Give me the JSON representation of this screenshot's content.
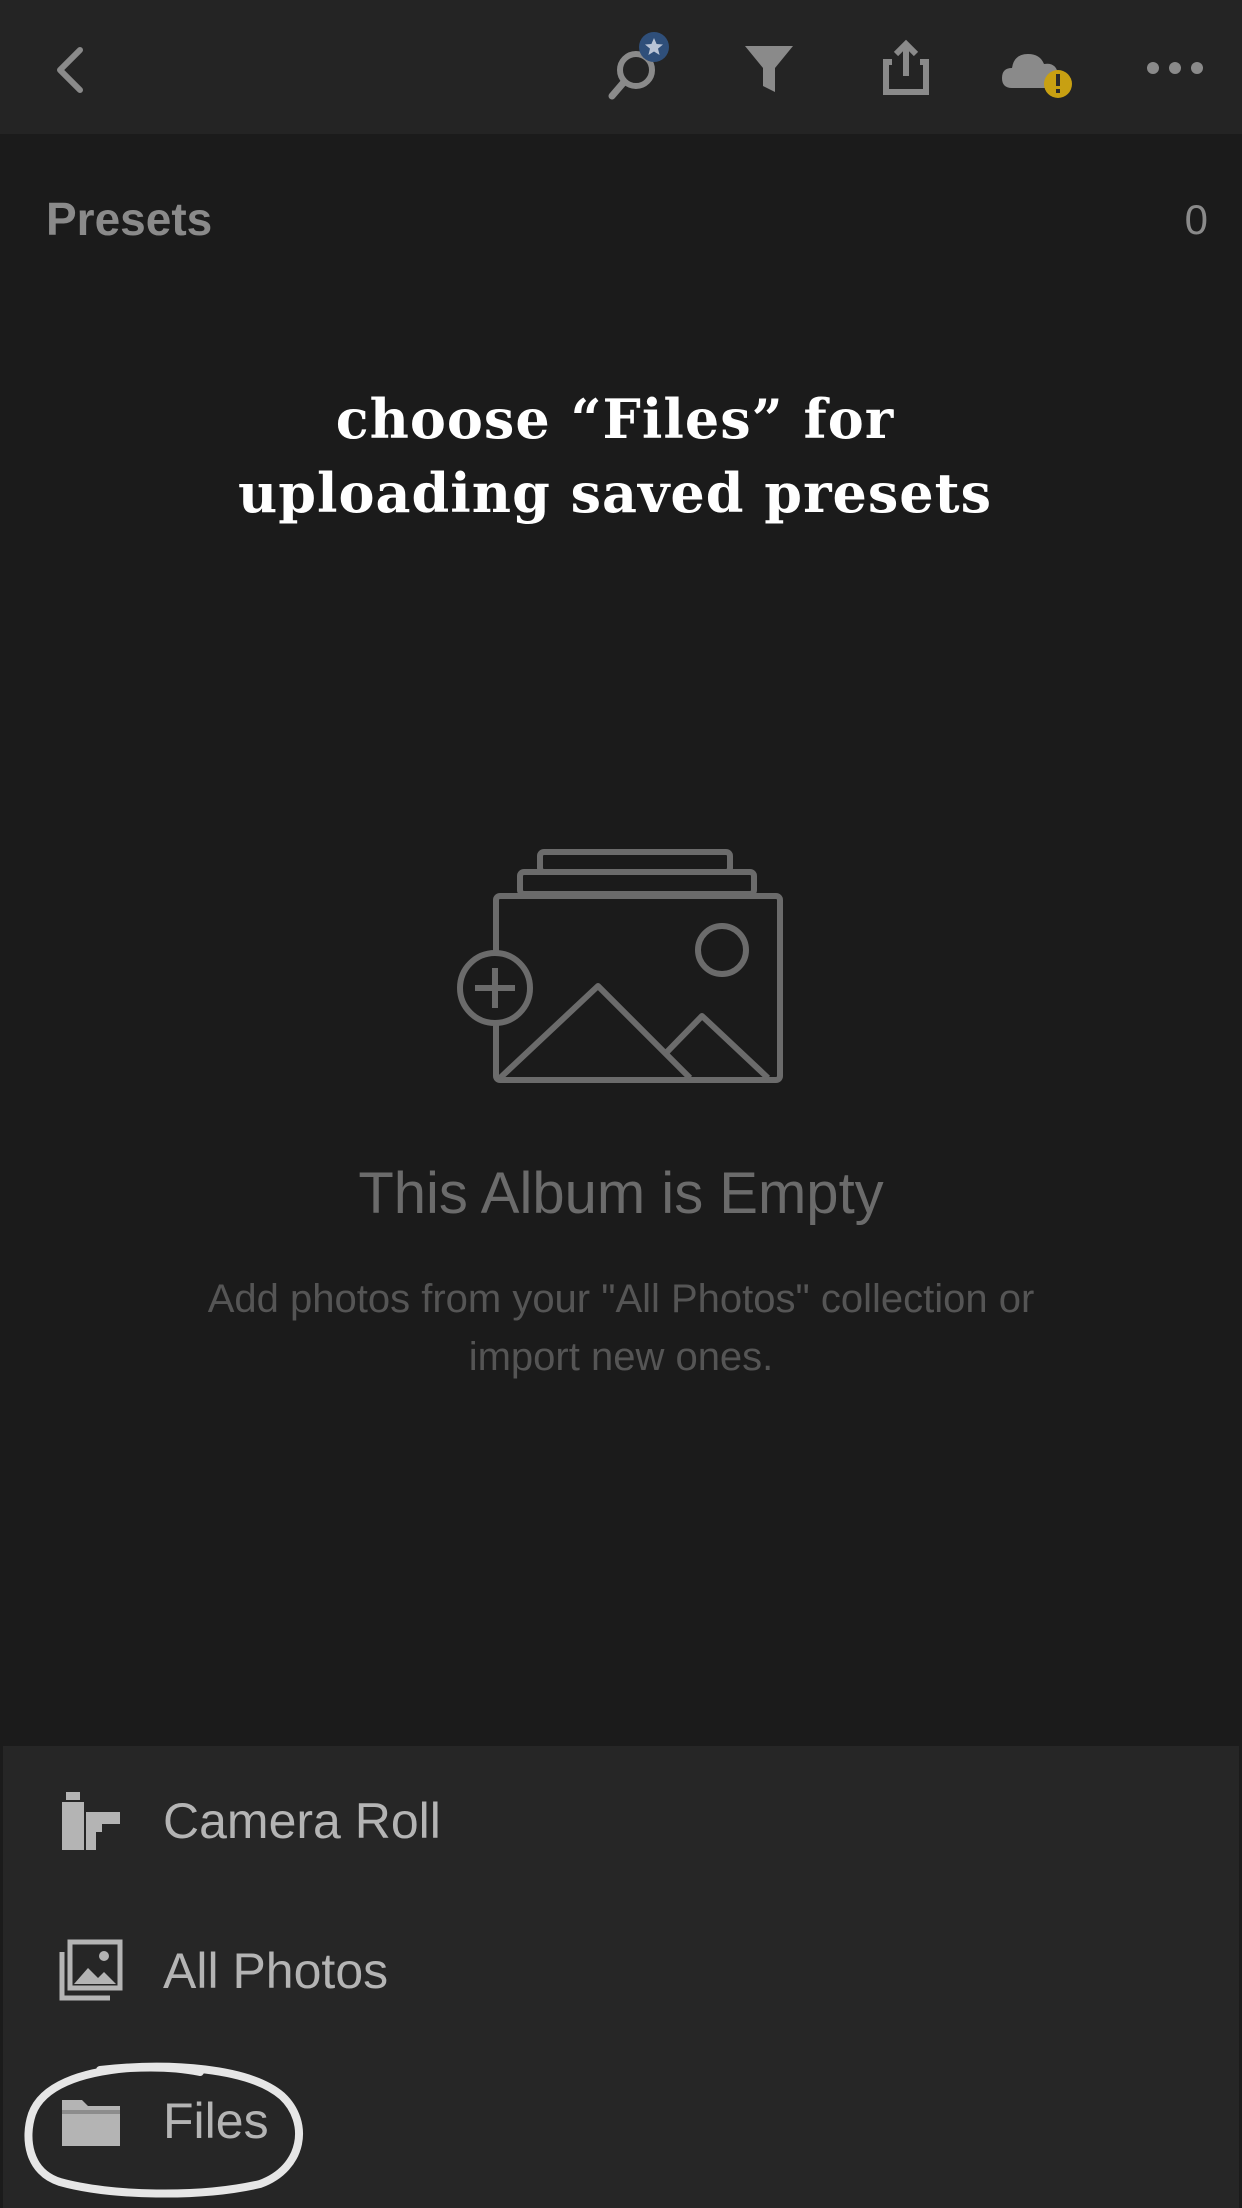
{
  "toolbar": {
    "icons": [
      "back-chevron-icon",
      "search-star-icon",
      "filter-icon",
      "share-icon",
      "cloud-warning-icon",
      "more-icon"
    ],
    "accent_star": "#2f4f7a",
    "warning_color": "#c8a012"
  },
  "album": {
    "title": "Presets",
    "count": "0"
  },
  "overlay": {
    "line1": "choose “Files” for",
    "line2": "uploading saved presets"
  },
  "empty_state": {
    "icon": "add-photo-stack-icon",
    "title": "This Album is Empty",
    "subtitle": "Add photos from your \"All Photos\" collection or import new ones."
  },
  "import_sheet": {
    "items": [
      {
        "icon": "camera-roll-icon",
        "label": "Camera Roll"
      },
      {
        "icon": "photos-icon",
        "label": "All Photos"
      },
      {
        "icon": "folder-icon",
        "label": "Files"
      }
    ]
  }
}
